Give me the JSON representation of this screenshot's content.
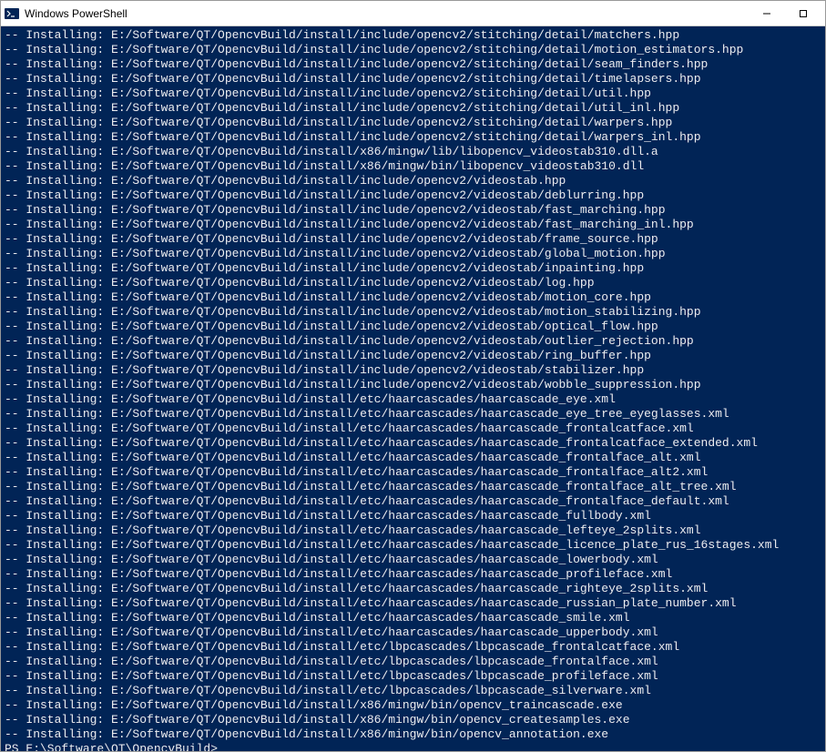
{
  "window": {
    "title": "Windows PowerShell",
    "minimize_label": "—",
    "maximize_label": "☐"
  },
  "terminal": {
    "prefix": "-- Installing: ",
    "lines": [
      "E:/Software/QT/OpencvBuild/install/include/opencv2/stitching/detail/matchers.hpp",
      "E:/Software/QT/OpencvBuild/install/include/opencv2/stitching/detail/motion_estimators.hpp",
      "E:/Software/QT/OpencvBuild/install/include/opencv2/stitching/detail/seam_finders.hpp",
      "E:/Software/QT/OpencvBuild/install/include/opencv2/stitching/detail/timelapsers.hpp",
      "E:/Software/QT/OpencvBuild/install/include/opencv2/stitching/detail/util.hpp",
      "E:/Software/QT/OpencvBuild/install/include/opencv2/stitching/detail/util_inl.hpp",
      "E:/Software/QT/OpencvBuild/install/include/opencv2/stitching/detail/warpers.hpp",
      "E:/Software/QT/OpencvBuild/install/include/opencv2/stitching/detail/warpers_inl.hpp",
      "E:/Software/QT/OpencvBuild/install/x86/mingw/lib/libopencv_videostab310.dll.a",
      "E:/Software/QT/OpencvBuild/install/x86/mingw/bin/libopencv_videostab310.dll",
      "E:/Software/QT/OpencvBuild/install/include/opencv2/videostab.hpp",
      "E:/Software/QT/OpencvBuild/install/include/opencv2/videostab/deblurring.hpp",
      "E:/Software/QT/OpencvBuild/install/include/opencv2/videostab/fast_marching.hpp",
      "E:/Software/QT/OpencvBuild/install/include/opencv2/videostab/fast_marching_inl.hpp",
      "E:/Software/QT/OpencvBuild/install/include/opencv2/videostab/frame_source.hpp",
      "E:/Software/QT/OpencvBuild/install/include/opencv2/videostab/global_motion.hpp",
      "E:/Software/QT/OpencvBuild/install/include/opencv2/videostab/inpainting.hpp",
      "E:/Software/QT/OpencvBuild/install/include/opencv2/videostab/log.hpp",
      "E:/Software/QT/OpencvBuild/install/include/opencv2/videostab/motion_core.hpp",
      "E:/Software/QT/OpencvBuild/install/include/opencv2/videostab/motion_stabilizing.hpp",
      "E:/Software/QT/OpencvBuild/install/include/opencv2/videostab/optical_flow.hpp",
      "E:/Software/QT/OpencvBuild/install/include/opencv2/videostab/outlier_rejection.hpp",
      "E:/Software/QT/OpencvBuild/install/include/opencv2/videostab/ring_buffer.hpp",
      "E:/Software/QT/OpencvBuild/install/include/opencv2/videostab/stabilizer.hpp",
      "E:/Software/QT/OpencvBuild/install/include/opencv2/videostab/wobble_suppression.hpp",
      "E:/Software/QT/OpencvBuild/install/etc/haarcascades/haarcascade_eye.xml",
      "E:/Software/QT/OpencvBuild/install/etc/haarcascades/haarcascade_eye_tree_eyeglasses.xml",
      "E:/Software/QT/OpencvBuild/install/etc/haarcascades/haarcascade_frontalcatface.xml",
      "E:/Software/QT/OpencvBuild/install/etc/haarcascades/haarcascade_frontalcatface_extended.xml",
      "E:/Software/QT/OpencvBuild/install/etc/haarcascades/haarcascade_frontalface_alt.xml",
      "E:/Software/QT/OpencvBuild/install/etc/haarcascades/haarcascade_frontalface_alt2.xml",
      "E:/Software/QT/OpencvBuild/install/etc/haarcascades/haarcascade_frontalface_alt_tree.xml",
      "E:/Software/QT/OpencvBuild/install/etc/haarcascades/haarcascade_frontalface_default.xml",
      "E:/Software/QT/OpencvBuild/install/etc/haarcascades/haarcascade_fullbody.xml",
      "E:/Software/QT/OpencvBuild/install/etc/haarcascades/haarcascade_lefteye_2splits.xml",
      "E:/Software/QT/OpencvBuild/install/etc/haarcascades/haarcascade_licence_plate_rus_16stages.xml",
      "E:/Software/QT/OpencvBuild/install/etc/haarcascades/haarcascade_lowerbody.xml",
      "E:/Software/QT/OpencvBuild/install/etc/haarcascades/haarcascade_profileface.xml",
      "E:/Software/QT/OpencvBuild/install/etc/haarcascades/haarcascade_righteye_2splits.xml",
      "E:/Software/QT/OpencvBuild/install/etc/haarcascades/haarcascade_russian_plate_number.xml",
      "E:/Software/QT/OpencvBuild/install/etc/haarcascades/haarcascade_smile.xml",
      "E:/Software/QT/OpencvBuild/install/etc/haarcascades/haarcascade_upperbody.xml",
      "E:/Software/QT/OpencvBuild/install/etc/lbpcascades/lbpcascade_frontalcatface.xml",
      "E:/Software/QT/OpencvBuild/install/etc/lbpcascades/lbpcascade_frontalface.xml",
      "E:/Software/QT/OpencvBuild/install/etc/lbpcascades/lbpcascade_profileface.xml",
      "E:/Software/QT/OpencvBuild/install/etc/lbpcascades/lbpcascade_silverware.xml",
      "E:/Software/QT/OpencvBuild/install/x86/mingw/bin/opencv_traincascade.exe",
      "E:/Software/QT/OpencvBuild/install/x86/mingw/bin/opencv_createsamples.exe",
      "E:/Software/QT/OpencvBuild/install/x86/mingw/bin/opencv_annotation.exe"
    ],
    "prompt": "PS E:\\Software\\QT\\OpencvBuild>"
  }
}
